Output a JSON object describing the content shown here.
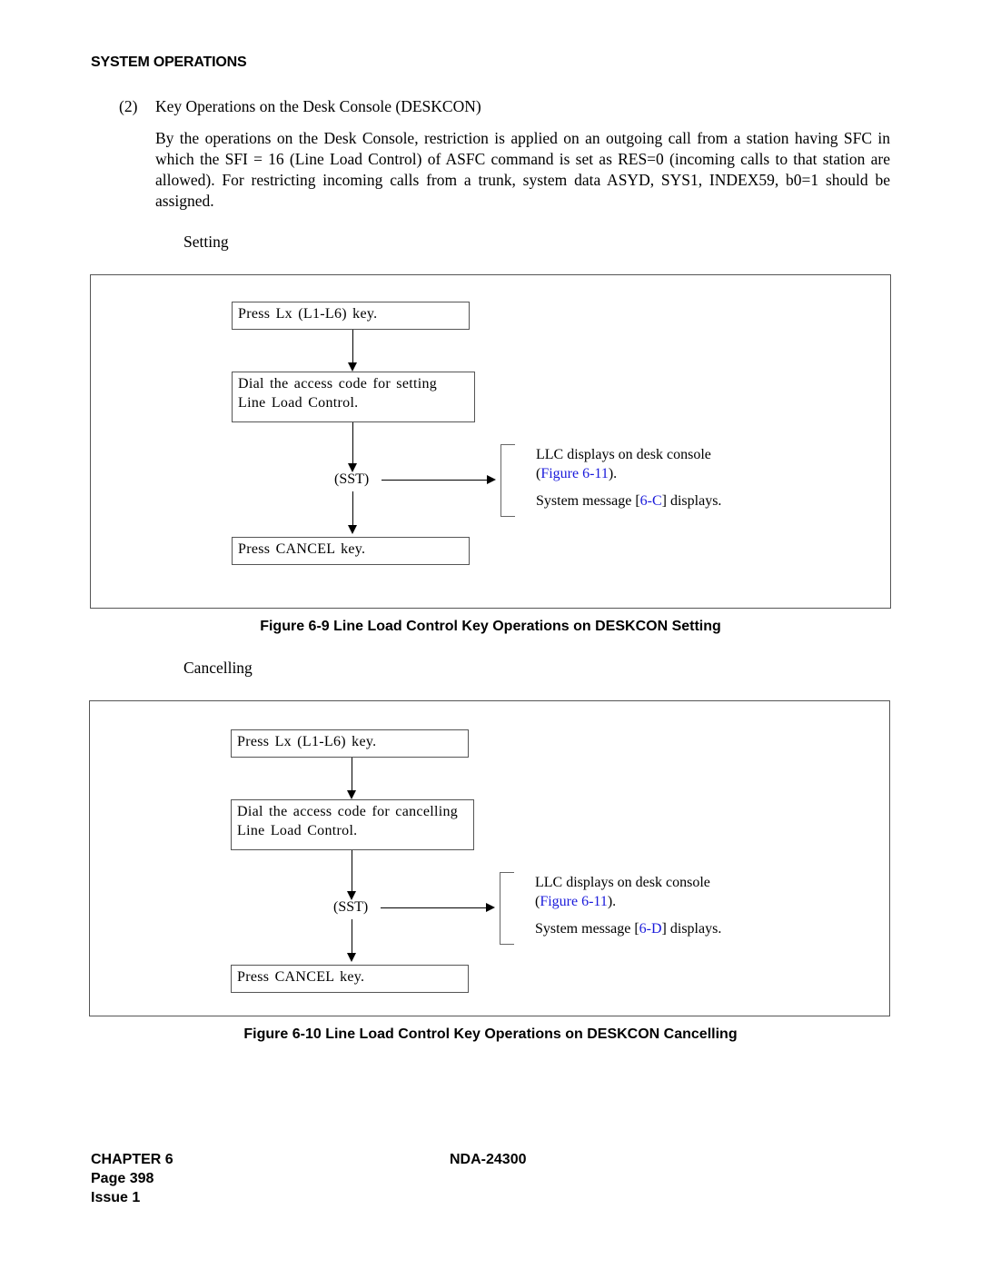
{
  "header": {
    "section": "SYSTEM OPERATIONS"
  },
  "section": {
    "number": "(2)",
    "title": "Key Operations on the Desk Console (DESKCON)",
    "paragraph": "By the operations on the Desk Console, restriction is applied on an outgoing call from a station having SFC in which the SFI = 16 (Line Load Control) of ASFC command is set as RES=0 (incoming calls to that station are allowed). For restricting incoming calls from a trunk, system data ASYD, SYS1, INDEX59, b0=1 should be assigned."
  },
  "figures": [
    {
      "subheading": "Setting",
      "steps": [
        "Press Lx (L1-L6) key.",
        "Dial the access code for setting",
        "Line Load Control.",
        "Press CANCEL key."
      ],
      "tone_label": "(SST)",
      "result": {
        "line1": "LLC displays on desk console",
        "line2_open": "(",
        "line2_link": "Figure 6-11",
        "line2_close": ").",
        "msg_prefix": "System message [",
        "msg_link": "6-C",
        "msg_suffix": "] displays."
      },
      "caption": "Figure 6-9   Line Load Control Key Operations on DESKCON   Setting"
    },
    {
      "subheading": "Cancelling",
      "steps": [
        "Press Lx (L1-L6) key.",
        "Dial the access code for cancelling",
        "Line Load Control.",
        "Press CANCEL key."
      ],
      "tone_label": "(SST)",
      "result": {
        "line1": "LLC displays on desk console",
        "line2_open": "(",
        "line2_link": "Figure 6-11",
        "line2_close": ").",
        "msg_prefix": "System message [",
        "msg_link": "6-D",
        "msg_suffix": "] displays."
      },
      "caption": "Figure 6-10   Line Load Control Key Operations on DESKCON   Cancelling"
    }
  ],
  "footer": {
    "chapter": "CHAPTER 6",
    "page": "Page 398",
    "issue": "Issue 1",
    "doc_number": "NDA-24300"
  },
  "colors": {
    "link": "#1a1adb",
    "text": "#000000",
    "frame": "#555555"
  }
}
